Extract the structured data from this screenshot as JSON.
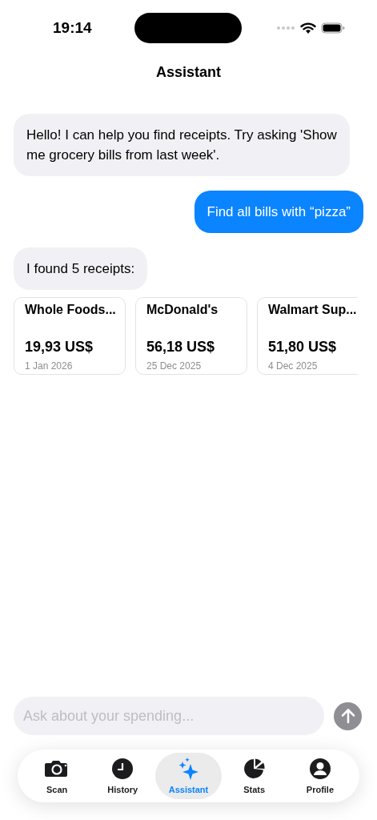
{
  "status_bar": {
    "time": "19:14"
  },
  "title": "Assistant",
  "messages": [
    {
      "kind": "assistant",
      "text": "Hello! I can help you find receipts. Try asking 'Show me grocery bills from last week'."
    },
    {
      "kind": "user",
      "text": "Find all bills with “pizza”"
    },
    {
      "kind": "assistant",
      "text": "I found 5 receipts:"
    }
  ],
  "receipts": [
    {
      "merchant": "Whole Foods...",
      "amount": "19,93 US$",
      "date": "1 Jan 2026"
    },
    {
      "merchant": "McDonald's",
      "amount": "56,18 US$",
      "date": "25 Dec 2025"
    },
    {
      "merchant": "Walmart Sup...",
      "amount": "51,80 US$",
      "date": "4 Dec 2025"
    }
  ],
  "input": {
    "placeholder": "Ask about your spending..."
  },
  "tabs": [
    {
      "label": "Scan",
      "selected": false
    },
    {
      "label": "History",
      "selected": false
    },
    {
      "label": "Assistant",
      "selected": true
    },
    {
      "label": "Stats",
      "selected": false
    },
    {
      "label": "Profile",
      "selected": false
    }
  ]
}
